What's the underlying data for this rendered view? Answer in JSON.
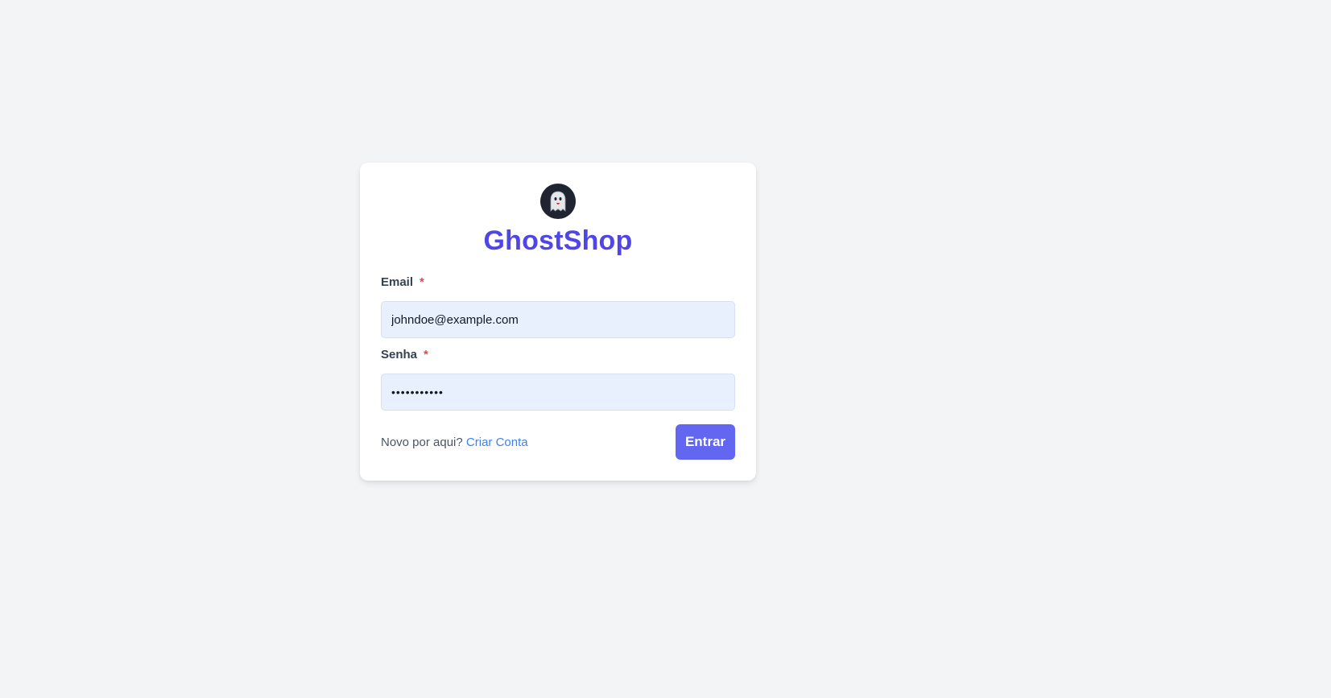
{
  "brand": {
    "name": "GhostShop",
    "icon": "ghost-icon",
    "color": "#4f46e5"
  },
  "form": {
    "email": {
      "label": "Email",
      "required_mark": "*",
      "value": "johndoe@example.com"
    },
    "password": {
      "label": "Senha",
      "required_mark": "*",
      "value": "•••••••••••"
    },
    "signup_prompt": "Novo por aqui?",
    "signup_link": "Criar Conta",
    "submit_label": "Entrar"
  },
  "colors": {
    "background": "#f3f4f6",
    "card": "#ffffff",
    "input_fill": "#e8f0fe",
    "required": "#ef4444",
    "link": "#3b82f6",
    "button": "#6366f1"
  }
}
